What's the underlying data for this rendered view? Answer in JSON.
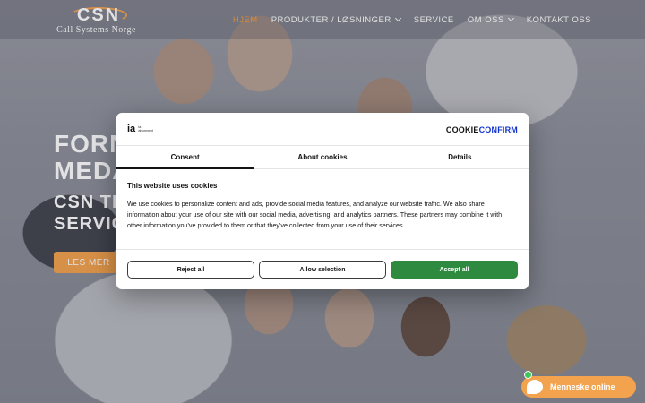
{
  "header": {
    "logo_mark": "CSN",
    "logo_text": "Call Systems Norge",
    "nav": [
      {
        "label": "HJEM",
        "active": true,
        "dropdown": false
      },
      {
        "label": "PRODUKTER / LØSNINGER",
        "active": false,
        "dropdown": true
      },
      {
        "label": "SERVICE",
        "active": false,
        "dropdown": false
      },
      {
        "label": "OM OSS",
        "active": false,
        "dropdown": true
      },
      {
        "label": "KONTAKT OSS",
        "active": false,
        "dropdown": false
      }
    ]
  },
  "hero": {
    "title_line1": "FORN",
    "title_line2": "MEDA",
    "sub_line1": "CSN TRA",
    "sub_line2": "SERVIC",
    "button": "LES MER"
  },
  "cookie_dialog": {
    "brand_mark": "ia",
    "brand_small_line1": "ia",
    "brand_small_line2": "abonnent",
    "provider_logo_part1": "C",
    "provider_logo_o": "O",
    "provider_logo_part2": "OKIE",
    "provider_logo_part3": "CONFIRM",
    "tabs": [
      {
        "label": "Consent",
        "active": true
      },
      {
        "label": "About cookies",
        "active": false
      },
      {
        "label": "Details",
        "active": false
      }
    ],
    "heading": "This website uses cookies",
    "body": "We use cookies to personalize content and ads, provide social media features, and analyze our website traffic. We also share information about your use of our site with our social media, advertising, and analytics partners. These partners may combine it with other information you've provided to them or that they've collected from your use of their services.",
    "buttons": {
      "reject": "Reject all",
      "allow": "Allow selection",
      "accept": "Accept all"
    }
  },
  "chat": {
    "label": "Menneske online"
  },
  "colors": {
    "accent": "#f3a24d",
    "nav_active": "#f39a3d",
    "accept_green": "#2d8a3e",
    "cookieconfirm_blue": "#1032cf",
    "online_green": "#3ec65a"
  }
}
